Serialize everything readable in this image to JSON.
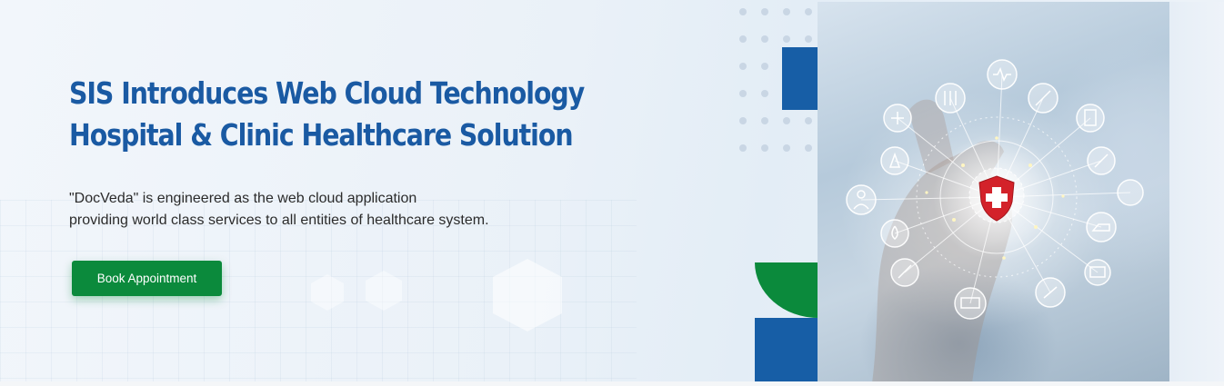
{
  "hero": {
    "headline_line1": "SIS Introduces Web Cloud Technology",
    "headline_line2": "Hospital & Clinic Healthcare Solution",
    "description_line1": "\"DocVeda\" is engineered as the web cloud application",
    "description_line2": "providing world class services to all entities of healthcare system.",
    "cta_label": "Book Appointment"
  },
  "colors": {
    "brand_blue": "#175ea6",
    "headline_blue": "#1a5aa3",
    "cta_green": "#0b8a3c",
    "shield_red": "#d3222a"
  },
  "icons": [
    "heart-rate-icon",
    "test-tubes-icon",
    "syringe-icon",
    "first-aid-kit-icon",
    "clipboard-icon",
    "pills-strip-icon",
    "doctor-icon",
    "iv-bag-icon",
    "blood-drop-icon",
    "ambulance-icon",
    "monitor-icon",
    "capsule-icon",
    "stethoscope-icon",
    "medical-shield-icon"
  ]
}
